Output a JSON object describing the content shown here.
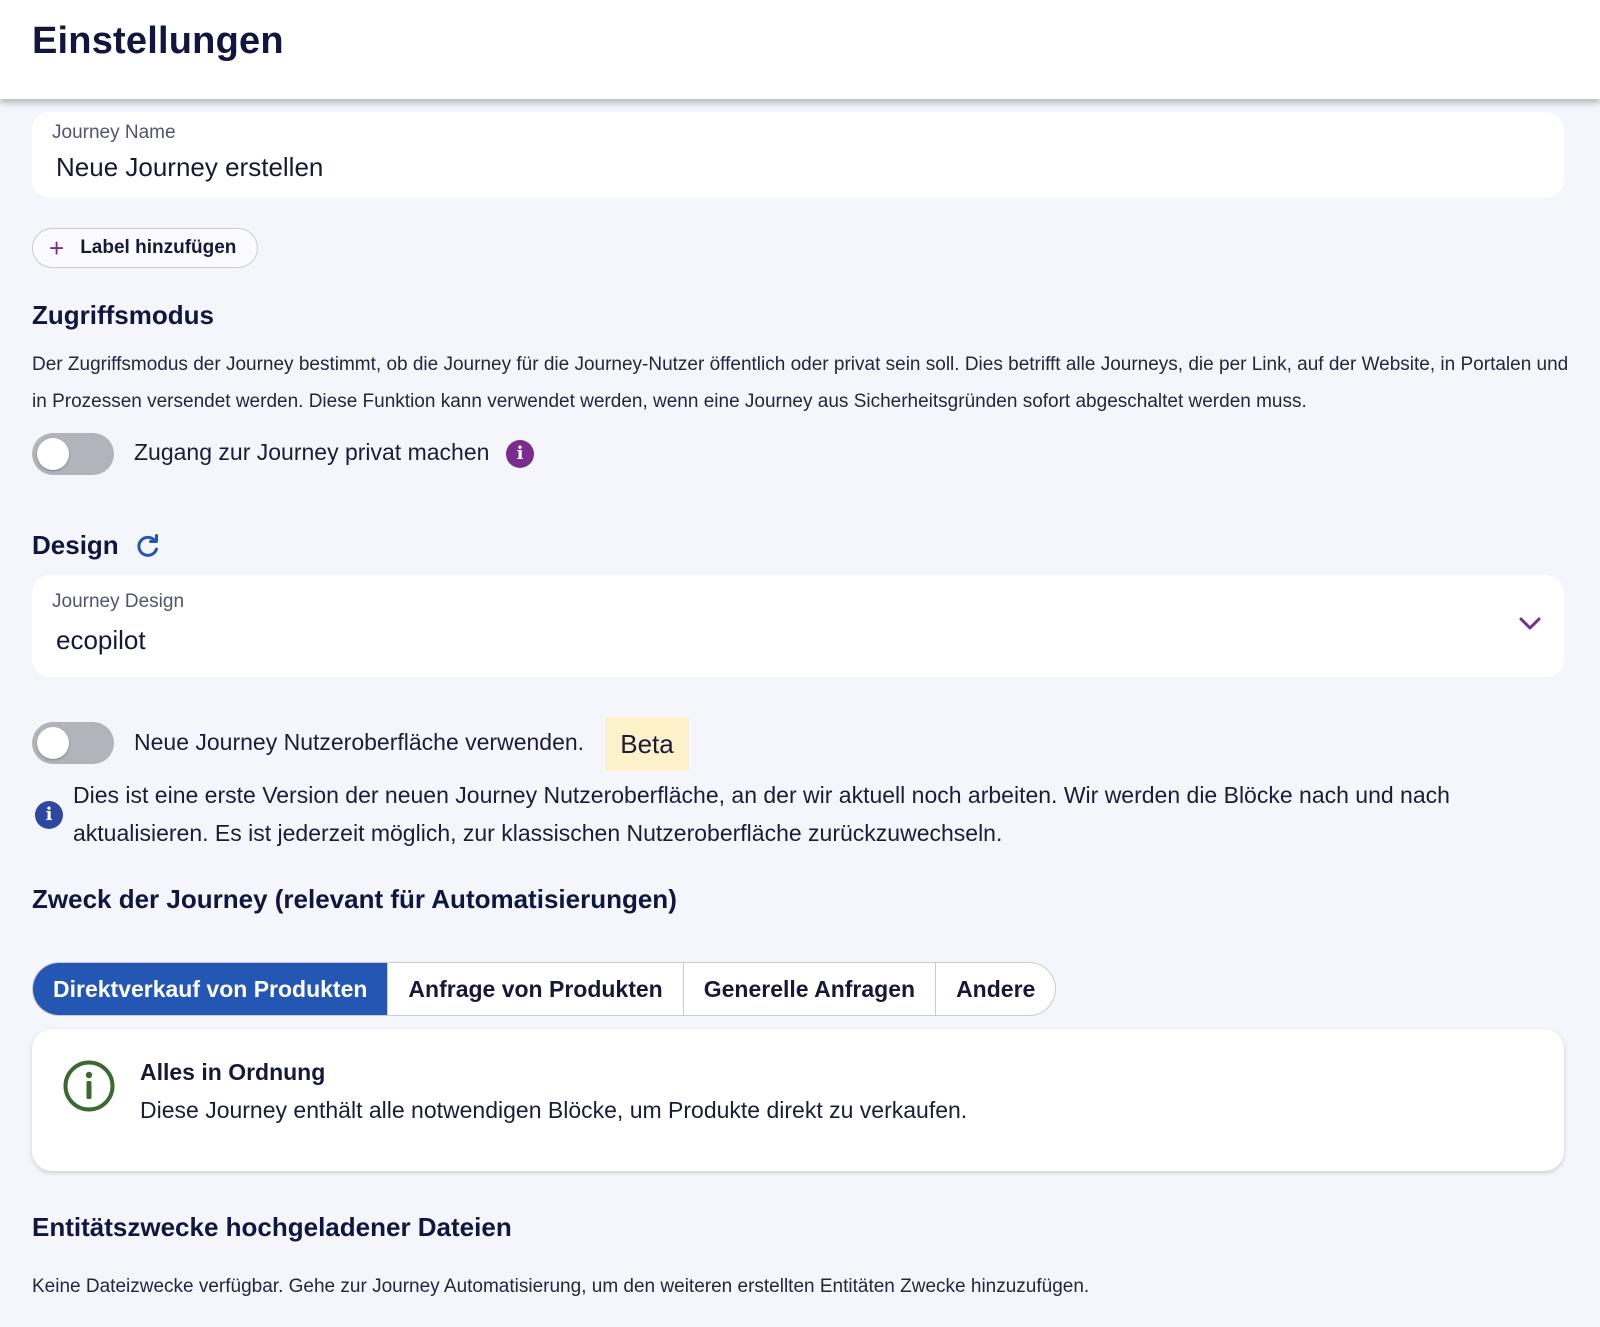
{
  "header": {
    "title": "Einstellungen"
  },
  "journey_name": {
    "label": "Journey Name",
    "value": "Neue Journey erstellen"
  },
  "label_button": {
    "label": "Label hinzufügen",
    "icon": "plus-icon"
  },
  "access": {
    "heading": "Zugriffsmodus",
    "description": "Der Zugriffsmodus der Journey bestimmt, ob die Journey für die Journey-Nutzer öffentlich oder privat sein soll. Dies betrifft alle Journeys, die per Link, auf der Website, in Portalen und in Prozessen versendet werden. Diese Funktion kann verwendet werden, wenn eine Journey aus Sicherheitsgründen sofort abgeschaltet werden muss.",
    "toggle_label": "Zugang zur Journey privat machen",
    "toggle_on": false
  },
  "design": {
    "heading": "Design",
    "field_label": "Journey Design",
    "field_value": "ecopilot",
    "new_ui_toggle_label": "Neue Journey Nutzeroberfläche verwenden.",
    "new_ui_toggle_on": false,
    "beta_badge": "Beta",
    "note": "Dies ist eine erste Version der neuen Journey Nutzeroberfläche, an der wir aktuell noch arbeiten. Wir werden die Blöcke nach und nach aktualisieren. Es ist jederzeit möglich, zur klassischen Nutzeroberfläche zurückzuwechseln."
  },
  "purpose": {
    "heading": "Zweck der Journey (relevant für Automatisierungen)",
    "options": [
      {
        "label": "Direktverkauf von Produkten",
        "active": true
      },
      {
        "label": "Anfrage von Produkten",
        "active": false
      },
      {
        "label": "Generelle Anfragen",
        "active": false
      },
      {
        "label": "Andere",
        "active": false
      }
    ],
    "alert": {
      "title": "Alles in Ordnung",
      "text": "Diese Journey enthält alle notwendigen Blöcke, um Produkte direkt zu verkaufen."
    }
  },
  "files": {
    "heading": "Entitätszwecke hochgeladener Dateien",
    "text": "Keine Dateizwecke verfügbar. Gehe zur Journey Automatisierung, um den weiteren erstellten Entitäten Zwecke hinzuzufügen."
  },
  "colors": {
    "accent": "#2456b4",
    "purple": "#7a2d8e",
    "success": "#3a6a2e",
    "beta_bg": "#fdf1c9"
  }
}
